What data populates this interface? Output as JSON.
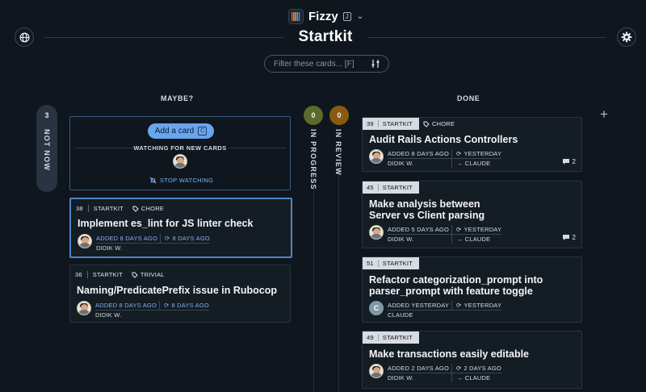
{
  "app": {
    "name": "Fizzy",
    "shortcut": "J"
  },
  "page": {
    "title": "Startkit"
  },
  "filter": {
    "placeholder": "Filter these cards... [F]"
  },
  "columns": {
    "not_now": {
      "label": "NOT NOW",
      "count": "3"
    },
    "maybe": {
      "label": "MAYBE?"
    },
    "in_progress": {
      "label": "IN PROGRESS",
      "count": "0"
    },
    "in_review": {
      "label": "IN REVIEW",
      "count": "0"
    },
    "done": {
      "label": "DONE"
    }
  },
  "watch": {
    "add_label": "Add a card",
    "add_shortcut": "C",
    "watching_label": "WATCHING FOR NEW CARDS",
    "stop_label": "STOP WATCHING"
  },
  "maybe_cards": [
    {
      "num": "38",
      "board": "STARTKIT",
      "tag": "CHORE",
      "title": "Implement es_lint for JS linter check",
      "added": "ADDED 8 DAYS AGO",
      "updated": "8 DAYS AGO",
      "author": "DIDIK W."
    },
    {
      "num": "36",
      "board": "STARTKIT",
      "tag": "TRIVIAL",
      "title": "Naming/PredicatePrefix issue in Rubocop",
      "added": "ADDED 8 DAYS AGO",
      "updated": "8 DAYS AGO",
      "author": "DIDIK W."
    }
  ],
  "done_cards": [
    {
      "num": "39",
      "board": "STARTKIT",
      "tag": "CHORE",
      "title": "Audit Rails Actions Controllers",
      "added": "ADDED 8 DAYS AGO",
      "updated": "YESTERDAY",
      "author": "DIDIK W.",
      "assignee": "CLAUDE",
      "comments": "2"
    },
    {
      "num": "45",
      "board": "STARTKIT",
      "title": "Make analysis between Server vs Client parsing",
      "added": "ADDED 5 DAYS AGO",
      "updated": "YESTERDAY",
      "author": "DIDIK W.",
      "assignee": "CLAUDE",
      "comments": "2"
    },
    {
      "num": "51",
      "board": "STARTKIT",
      "title": "Refactor categorization_prompt into parser_prompt with feature toggle",
      "added": "ADDED YESTERDAY",
      "updated": "YESTERDAY",
      "author": "CLAUDE",
      "avatar_letter": "C"
    },
    {
      "num": "49",
      "board": "STARTKIT",
      "title": "Make transactions easily editable",
      "added": "ADDED 2 DAYS AGO",
      "updated": "2 DAYS AGO",
      "author": "DIDIK W.",
      "assignee": "CLAUDE"
    }
  ],
  "icons": {
    "globe": "globe-icon",
    "gear": "gear-icon",
    "filter": "sliders-icon",
    "tag": "tag-icon",
    "updated": "refresh-icon",
    "assignee": "arrow-right-icon",
    "comment": "comment-icon",
    "bell_off": "bell-off-icon",
    "add": "plus-icon"
  },
  "colors": {
    "background": "#0f161d",
    "accent_blue": "#6aa6ef",
    "in_progress": "#5e6a2a",
    "in_review": "#8a5a12"
  }
}
